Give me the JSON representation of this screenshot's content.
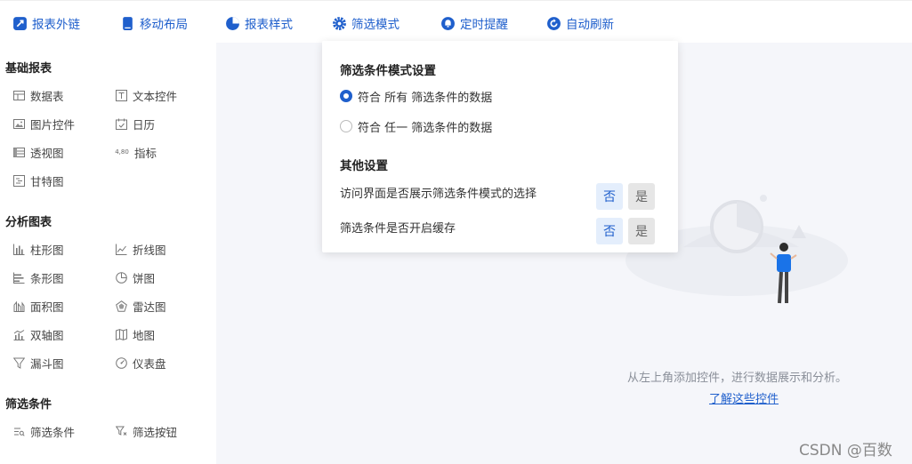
{
  "toolbar": {
    "items": [
      {
        "label": "报表外链",
        "icon": "link-icon"
      },
      {
        "label": "移动布局",
        "icon": "mobile-icon"
      },
      {
        "label": "报表样式",
        "icon": "palette-icon"
      },
      {
        "label": "筛选模式",
        "icon": "gear-icon"
      },
      {
        "label": "定时提醒",
        "icon": "bell-icon"
      },
      {
        "label": "自动刷新",
        "icon": "refresh-icon"
      }
    ],
    "accent": "#1f5fcc"
  },
  "sidebar": {
    "sections": [
      {
        "title": "基础报表",
        "items": [
          {
            "label": "数据表",
            "icon": "table-icon"
          },
          {
            "label": "文本控件",
            "icon": "text-icon"
          },
          {
            "label": "图片控件",
            "icon": "image-icon"
          },
          {
            "label": "日历",
            "icon": "calendar-icon"
          },
          {
            "label": "透视图",
            "icon": "pivot-icon"
          },
          {
            "label": "指标",
            "icon": "metric-icon",
            "glyph": "4,80"
          },
          {
            "label": "甘特图",
            "icon": "gantt-icon"
          }
        ]
      },
      {
        "title": "分析图表",
        "items": [
          {
            "label": "柱形图",
            "icon": "column-chart-icon"
          },
          {
            "label": "折线图",
            "icon": "line-chart-icon"
          },
          {
            "label": "条形图",
            "icon": "bar-chart-icon"
          },
          {
            "label": "饼图",
            "icon": "pie-chart-icon"
          },
          {
            "label": "面积图",
            "icon": "area-chart-icon"
          },
          {
            "label": "雷达图",
            "icon": "radar-chart-icon"
          },
          {
            "label": "双轴图",
            "icon": "dual-axis-icon"
          },
          {
            "label": "地图",
            "icon": "map-icon"
          },
          {
            "label": "漏斗图",
            "icon": "funnel-icon"
          },
          {
            "label": "仪表盘",
            "icon": "gauge-icon"
          }
        ]
      },
      {
        "title": "筛选条件",
        "items": [
          {
            "label": "筛选条件",
            "icon": "filter-list-icon"
          },
          {
            "label": "筛选按钮",
            "icon": "filter-button-icon"
          }
        ]
      }
    ]
  },
  "popover": {
    "mode_title": "筛选条件模式设置",
    "options": [
      {
        "label": "符合 所有 筛选条件的数据",
        "checked": true
      },
      {
        "label": "符合 任一 筛选条件的数据",
        "checked": false
      }
    ],
    "other_title": "其他设置",
    "settings": [
      {
        "label": "访问界面是否展示筛选条件模式的选择",
        "no": "否",
        "yes": "是",
        "value": "否"
      },
      {
        "label": "筛选条件是否开启缓存",
        "no": "否",
        "yes": "是",
        "value": "否"
      }
    ]
  },
  "empty_state": {
    "hint": "从左上角添加控件，进行数据展示和分析。",
    "link": "了解这些控件"
  },
  "watermark": "CSDN @百数"
}
